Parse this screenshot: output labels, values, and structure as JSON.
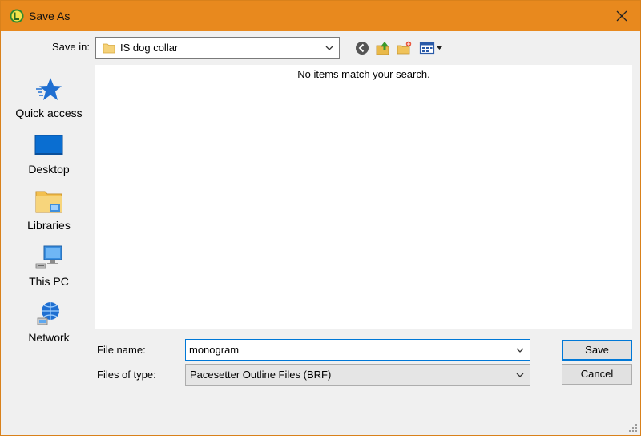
{
  "window": {
    "title": "Save As",
    "accent": "#e8891e"
  },
  "toolbar": {
    "save_in_label": "Save in:",
    "save_in_value": "IS dog collar",
    "icons": [
      "back-icon",
      "up-folder-icon",
      "new-folder-icon",
      "view-menu-icon"
    ]
  },
  "places": [
    {
      "label": "Quick access",
      "icon": "quick-access-star-icon"
    },
    {
      "label": "Desktop",
      "icon": "desktop-icon"
    },
    {
      "label": "Libraries",
      "icon": "libraries-icon"
    },
    {
      "label": "This PC",
      "icon": "this-pc-icon"
    },
    {
      "label": "Network",
      "icon": "network-icon"
    }
  ],
  "file_list": {
    "empty_message": "No items match your search."
  },
  "form": {
    "file_name_label": "File name:",
    "file_name_value": "monogram",
    "file_type_label": "Files of type:",
    "file_type_value": "Pacesetter Outline Files (BRF)"
  },
  "buttons": {
    "save": "Save",
    "cancel": "Cancel"
  }
}
